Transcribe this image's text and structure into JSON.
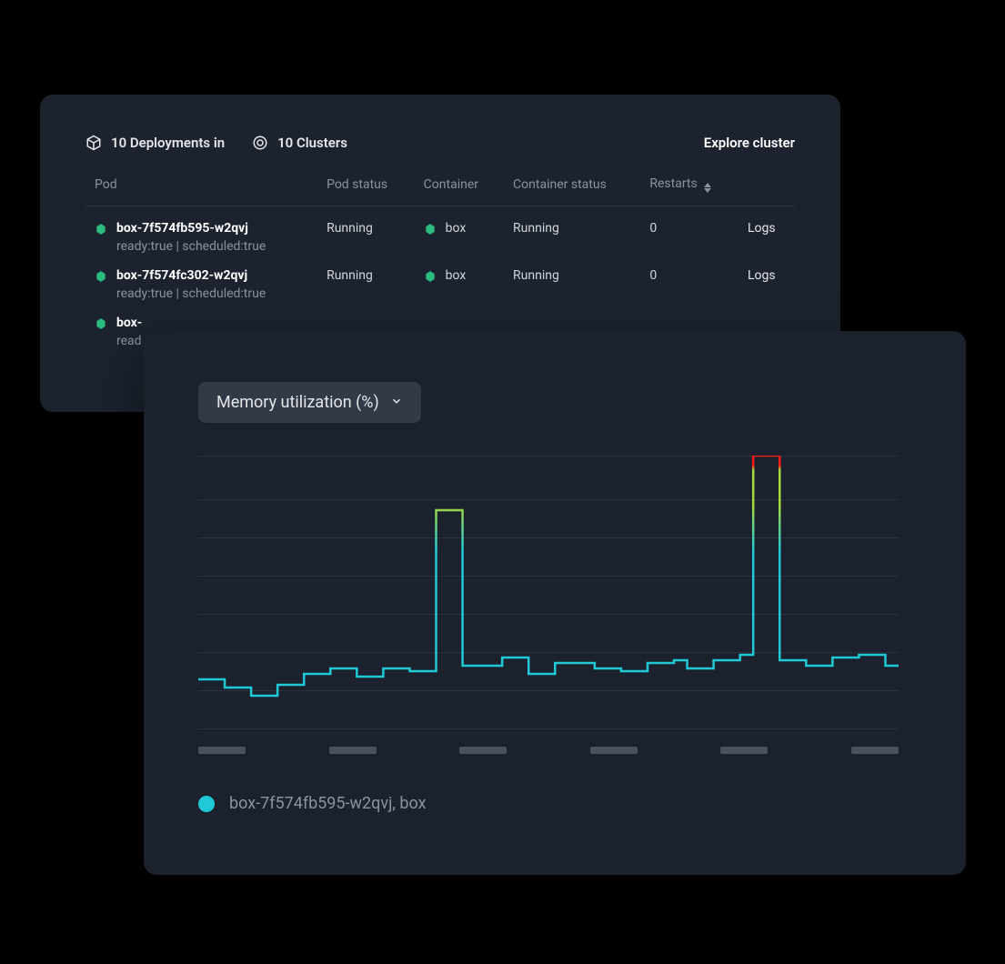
{
  "header": {
    "deployments_label": "10 Deployments in",
    "clusters_label": "10 Clusters",
    "explore_label": "Explore cluster"
  },
  "table": {
    "columns": {
      "pod": "Pod",
      "pod_status": "Pod status",
      "container": "Container",
      "container_status": "Container status",
      "restarts": "Restarts",
      "logs": ""
    },
    "rows": [
      {
        "pod_name": "box-7f574fb595-w2qvj",
        "pod_sub": "ready:true | scheduled:true",
        "pod_status": "Running",
        "container": "box",
        "container_status": "Running",
        "restarts": "0",
        "logs_label": "Logs"
      },
      {
        "pod_name": "box-7f574fc302-w2qvj",
        "pod_sub": "ready:true | scheduled:true",
        "pod_status": "Running",
        "container": "box",
        "container_status": "Running",
        "restarts": "0",
        "logs_label": "Logs"
      },
      {
        "pod_name": "box-",
        "pod_sub": "read",
        "pod_status": "",
        "container": "",
        "container_status": "",
        "restarts": "",
        "logs_label": ""
      }
    ]
  },
  "metric_panel": {
    "selector_label": "Memory utilization (%)",
    "legend_label": "box-7f574fb595-w2qvj, box"
  },
  "chart_data": {
    "type": "line",
    "title": "Memory utilization (%)",
    "xlabel": "",
    "ylabel": "",
    "ylim": [
      0,
      100
    ],
    "grid_y": [
      0,
      14,
      28,
      42,
      56,
      70,
      84,
      100
    ],
    "series": [
      {
        "name": "box-7f574fb595-w2qvj, box",
        "color_gradient": [
          "#1fc9d6",
          "#a8d93b",
          "#ff1a1a"
        ],
        "x": [
          0,
          1,
          2,
          3,
          4,
          5,
          6,
          7,
          8,
          9,
          10,
          11,
          12,
          13,
          14,
          15,
          16,
          17,
          18,
          19,
          20,
          21,
          22,
          23,
          24,
          25,
          26,
          27,
          28,
          29,
          30,
          31,
          32,
          33,
          34,
          35,
          36,
          37,
          38,
          39,
          40,
          41,
          42,
          43,
          44,
          45,
          46,
          47,
          48,
          49,
          50,
          51,
          52,
          53
        ],
        "y": [
          18,
          18,
          15,
          15,
          12,
          12,
          16,
          16,
          20,
          20,
          22,
          22,
          19,
          19,
          22,
          22,
          21,
          21,
          80,
          80,
          23,
          23,
          23,
          26,
          26,
          20,
          20,
          24,
          24,
          24,
          22,
          22,
          21,
          21,
          24,
          24,
          25,
          22,
          22,
          25,
          25,
          27,
          100,
          100,
          25,
          25,
          23,
          23,
          26,
          26,
          27,
          27,
          23,
          23
        ]
      }
    ],
    "x_tick_count": 6
  }
}
